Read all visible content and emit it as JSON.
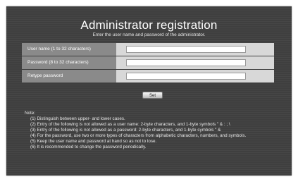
{
  "header": {
    "title": "Administrator registration",
    "subtitle": "Enter the user name and password of the administrator."
  },
  "form": {
    "rows": [
      {
        "label": "User name (1 to 32 characters)",
        "value": ""
      },
      {
        "label": "Password (8 to 32 characters)",
        "value": ""
      },
      {
        "label": "Retype password",
        "value": ""
      }
    ],
    "set_label": "Set"
  },
  "notes": {
    "title": "Note:",
    "items": [
      "(1) Distinguish between upper- and lower cases.",
      "(2) Entry of the following is not allowed as a user name:   2-byte characters, and 1-byte symbols \" & : ; \\",
      "(3) Entry of the following is not allowed as a password:   2-byte characters, and 1-byte symbols \" &",
      "(4) For the password, use two or more types of characters from alphabetic characters, numbers, and symbols.",
      "(5) Keep the user name and password at hand so as not to lose.",
      "(6) It is recommended to change the password periodically."
    ]
  }
}
